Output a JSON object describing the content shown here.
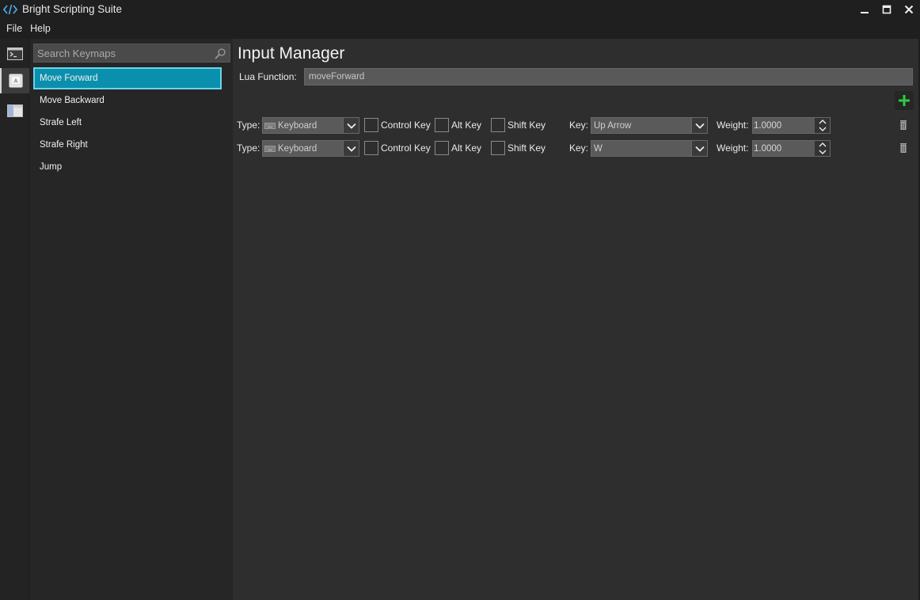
{
  "app": {
    "title": "Bright Scripting Suite"
  },
  "menu": [
    "File",
    "Help"
  ],
  "sidebar": {
    "search_placeholder": "Search Keymaps",
    "items": [
      {
        "label": "Move Forward",
        "selected": true
      },
      {
        "label": "Move Backward",
        "selected": false
      },
      {
        "label": "Strafe Left",
        "selected": false
      },
      {
        "label": "Strafe Right",
        "selected": false
      },
      {
        "label": "Jump",
        "selected": false
      }
    ]
  },
  "main": {
    "title": "Input Manager",
    "lua_label": "Lua Function:",
    "lua_value": "moveForward",
    "labels": {
      "type": "Type:",
      "control": "Control Key",
      "alt": "Alt Key",
      "shift": "Shift Key",
      "key": "Key:",
      "weight": "Weight:"
    },
    "bindings": [
      {
        "type": "Keyboard",
        "control": false,
        "alt": false,
        "shift": false,
        "key": "Up Arrow",
        "weight": "1.0000"
      },
      {
        "type": "Keyboard",
        "control": false,
        "alt": false,
        "shift": false,
        "key": "W",
        "weight": "1.0000"
      }
    ]
  },
  "colors": {
    "accent": "#0a90ad",
    "accent_border": "#6ad4ec",
    "add_green": "#2ecc40"
  }
}
